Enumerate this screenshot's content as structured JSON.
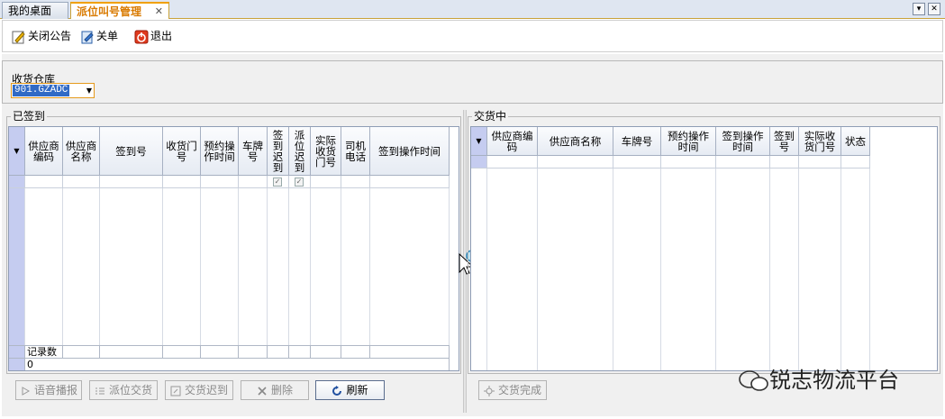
{
  "tabs": [
    {
      "label": "我的桌面"
    },
    {
      "label": "派位叫号管理",
      "close": "✕"
    }
  ],
  "window_controls": {
    "dropdown": "▾",
    "close": "✕"
  },
  "toolbar": {
    "close_notice": "关闭公告",
    "close_order": "关单",
    "exit": "退出"
  },
  "warehouse": {
    "label": "收货仓库",
    "value": "901.GZADC"
  },
  "signed_in": {
    "title": "已签到",
    "columns": [
      "供应商编码",
      "供应商名称",
      "签到号",
      "收货门号",
      "预约操作时间",
      "车牌号",
      "签到迟到",
      "派位迟到",
      "实际收货门号",
      "司机电话",
      "签到操作时间"
    ],
    "footer_label": "记录数",
    "footer_count": "0"
  },
  "delivering": {
    "title": "交货中",
    "columns": [
      "供应商编码",
      "供应商名称",
      "车牌号",
      "预约操作时间",
      "签到操作时间",
      "签到号",
      "实际收货门号",
      "状态"
    ]
  },
  "buttons": {
    "voice": "语音播报",
    "assign": "派位交货",
    "late": "交货迟到",
    "delete": "删除",
    "refresh": "刷新",
    "complete": "交货完成"
  },
  "watermark": "锐志物流平台",
  "colors": {
    "accent": "#f0a000",
    "selection": "#316ac5",
    "grid_indicator": "#c5ccf0"
  }
}
